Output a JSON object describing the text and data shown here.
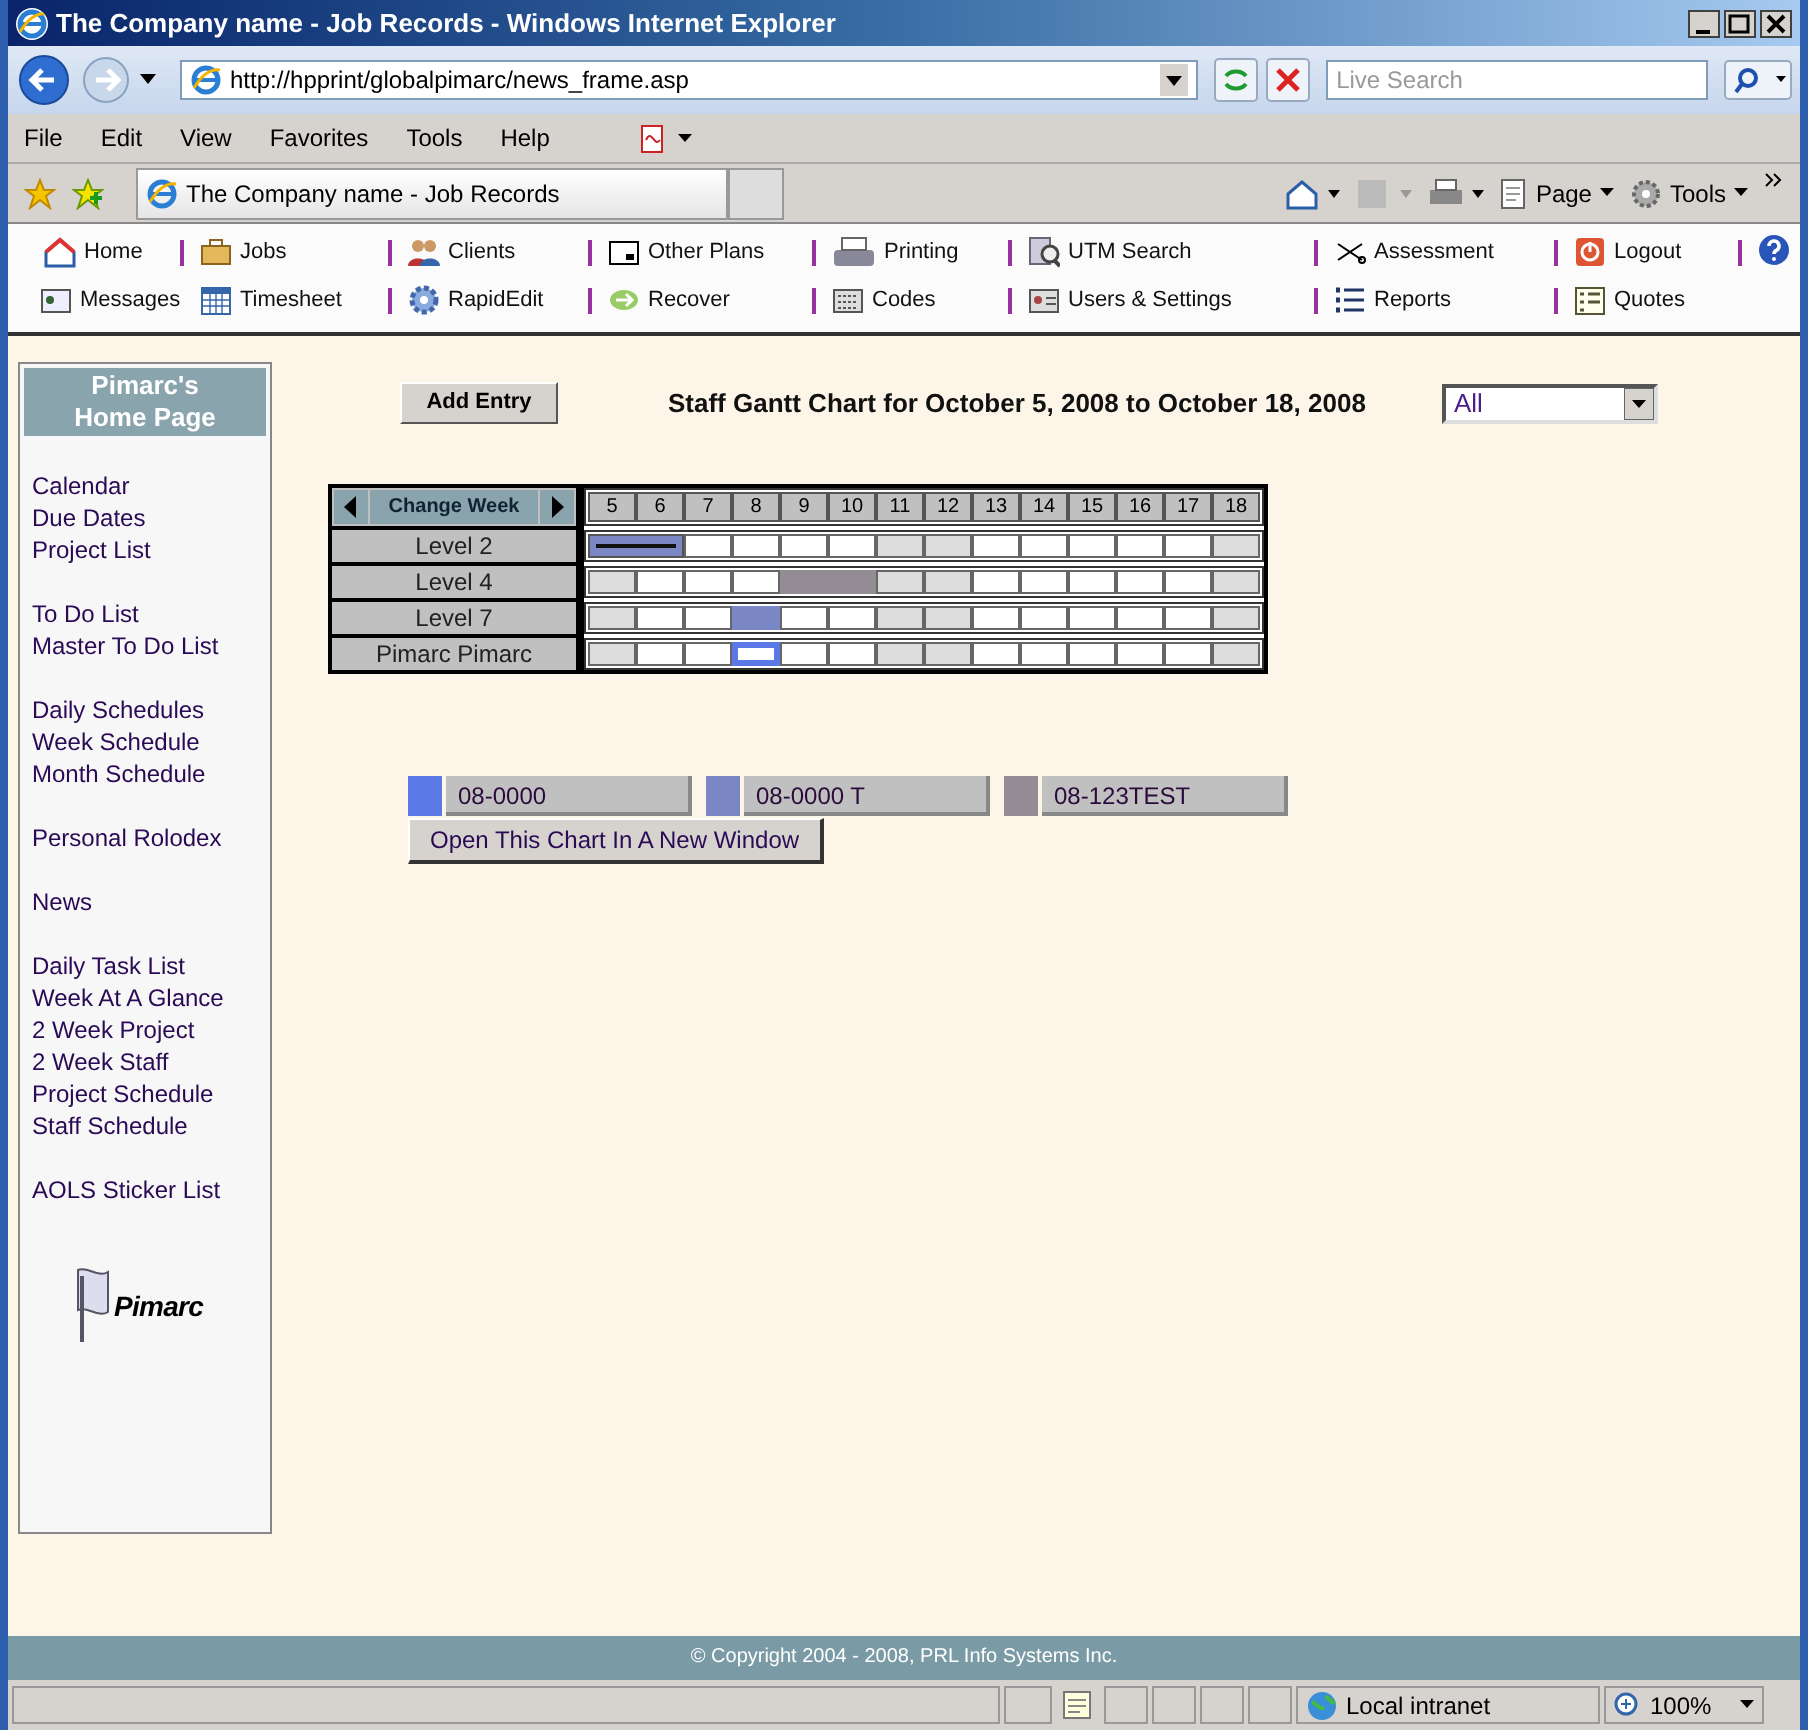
{
  "window": {
    "title": "The Company name - Job Records - Windows Internet Explorer"
  },
  "address_bar": {
    "url": "http://hpprint/globalpimarc/news_frame.asp"
  },
  "search": {
    "placeholder": "Live Search"
  },
  "menu": [
    "File",
    "Edit",
    "View",
    "Favorites",
    "Tools",
    "Help"
  ],
  "tab": {
    "title": "The Company name - Job Records"
  },
  "command_bar": [
    "Page",
    "Tools"
  ],
  "nav": [
    [
      {
        "kind": "link",
        "label": "Home",
        "divider": false
      },
      {
        "kind": "link",
        "label": "Jobs",
        "divider": true
      },
      {
        "kind": "link",
        "label": "Clients",
        "divider": true
      },
      {
        "kind": "link",
        "label": "Other Plans",
        "divider": true
      },
      {
        "kind": "link",
        "label": "Printing",
        "divider": true
      },
      {
        "kind": "link",
        "label": "UTM Search",
        "divider": true
      },
      {
        "kind": "link",
        "label": "Assessment",
        "divider": true
      },
      {
        "kind": "link",
        "label": "Logout",
        "divider": true
      },
      {
        "kind": "help",
        "divider": true
      }
    ],
    [
      {
        "kind": "link",
        "label": "Messages",
        "divider": false
      },
      {
        "kind": "link",
        "label": "Timesheet",
        "divider": false
      },
      {
        "kind": "link",
        "label": "RapidEdit",
        "divider": true
      },
      {
        "kind": "link",
        "label": "Recover",
        "divider": true
      },
      {
        "kind": "link",
        "label": "Codes",
        "divider": true
      },
      {
        "kind": "link",
        "label": "Users & Settings",
        "divider": true
      },
      {
        "kind": "link",
        "label": "Reports",
        "divider": true
      },
      {
        "kind": "link",
        "label": "Quotes",
        "divider": true
      }
    ]
  ],
  "sidebar": {
    "title": "Pimarc's Home Page",
    "groups": [
      [
        "Calendar",
        "Due Dates",
        "Project List"
      ],
      [
        "To Do List",
        "Master To Do List"
      ],
      [
        "Daily Schedules",
        "Week Schedule",
        "Month Schedule"
      ],
      [
        "Personal Rolodex"
      ],
      [
        "News"
      ],
      [
        "Daily Task List",
        "Week At A Glance",
        "2 Week Project",
        "2 Week Staff",
        "Project Schedule",
        "Staff Schedule"
      ],
      [
        "AOLS Sticker List"
      ]
    ],
    "logo": "Pimarc"
  },
  "toolbar": {
    "add_button": "Add Entry",
    "heading": "Staff Gantt Chart for October 5, 2008 to October 18, 2008",
    "filter": "All"
  },
  "gantt": {
    "change_week": "Change Week",
    "days": [
      {
        "label": "5",
        "weekend": true
      },
      {
        "label": "6",
        "weekend": false
      },
      {
        "label": "7",
        "weekend": false
      },
      {
        "label": "8",
        "weekend": false
      },
      {
        "label": "9",
        "weekend": false
      },
      {
        "label": "10",
        "weekend": false
      },
      {
        "label": "11",
        "weekend": true
      },
      {
        "label": "12",
        "weekend": true
      },
      {
        "label": "13",
        "weekend": false
      },
      {
        "label": "14",
        "weekend": false
      },
      {
        "label": "15",
        "weekend": false
      },
      {
        "label": "16",
        "weekend": false
      },
      {
        "label": "17",
        "weekend": false
      },
      {
        "label": "18",
        "weekend": true
      }
    ],
    "rows": [
      {
        "label": "Level 2",
        "cells": [
          {
            "kind": "underline",
            "color": "#7b86c4"
          },
          {
            "kind": "underline",
            "color": "#7b86c4"
          },
          {
            "kind": "empty"
          },
          {
            "kind": "empty"
          },
          {
            "kind": "empty"
          },
          {
            "kind": "empty"
          },
          {
            "kind": "empty"
          },
          {
            "kind": "empty"
          },
          {
            "kind": "empty"
          },
          {
            "kind": "empty"
          },
          {
            "kind": "empty"
          },
          {
            "kind": "empty"
          },
          {
            "kind": "empty"
          },
          {
            "kind": "empty"
          }
        ]
      },
      {
        "label": "Level 4",
        "cells": [
          {
            "kind": "empty"
          },
          {
            "kind": "empty"
          },
          {
            "kind": "empty"
          },
          {
            "kind": "empty"
          },
          {
            "kind": "solid",
            "color": "#948c94"
          },
          {
            "kind": "solid",
            "color": "#948c94"
          },
          {
            "kind": "empty"
          },
          {
            "kind": "empty"
          },
          {
            "kind": "empty"
          },
          {
            "kind": "empty"
          },
          {
            "kind": "empty"
          },
          {
            "kind": "empty"
          },
          {
            "kind": "empty"
          },
          {
            "kind": "empty"
          }
        ]
      },
      {
        "label": "Level 7",
        "cells": [
          {
            "kind": "empty"
          },
          {
            "kind": "empty"
          },
          {
            "kind": "empty"
          },
          {
            "kind": "solid",
            "color": "#7b86c4"
          },
          {
            "kind": "empty"
          },
          {
            "kind": "empty"
          },
          {
            "kind": "empty"
          },
          {
            "kind": "empty"
          },
          {
            "kind": "empty"
          },
          {
            "kind": "empty"
          },
          {
            "kind": "empty"
          },
          {
            "kind": "empty"
          },
          {
            "kind": "empty"
          },
          {
            "kind": "empty"
          }
        ]
      },
      {
        "label": "Pimarc Pimarc",
        "cells": [
          {
            "kind": "empty"
          },
          {
            "kind": "empty"
          },
          {
            "kind": "empty"
          },
          {
            "kind": "outline",
            "color": "#5a78e6"
          },
          {
            "kind": "empty"
          },
          {
            "kind": "empty"
          },
          {
            "kind": "empty"
          },
          {
            "kind": "empty"
          },
          {
            "kind": "empty"
          },
          {
            "kind": "empty"
          },
          {
            "kind": "empty"
          },
          {
            "kind": "empty"
          },
          {
            "kind": "empty"
          },
          {
            "kind": "empty"
          }
        ]
      }
    ]
  },
  "legend": [
    {
      "label": "08-0000",
      "color": "#5a78e6"
    },
    {
      "label": "08-0000 T",
      "color": "#7b86c4"
    },
    {
      "label": "08-123TEST",
      "color": "#948c94"
    }
  ],
  "open_button": "Open This Chart In A New Window",
  "footer": "© Copyright 2004 - 2008, PRL Info Systems Inc.",
  "status_bar": {
    "zone": "Local intranet",
    "zoom": "100%"
  }
}
